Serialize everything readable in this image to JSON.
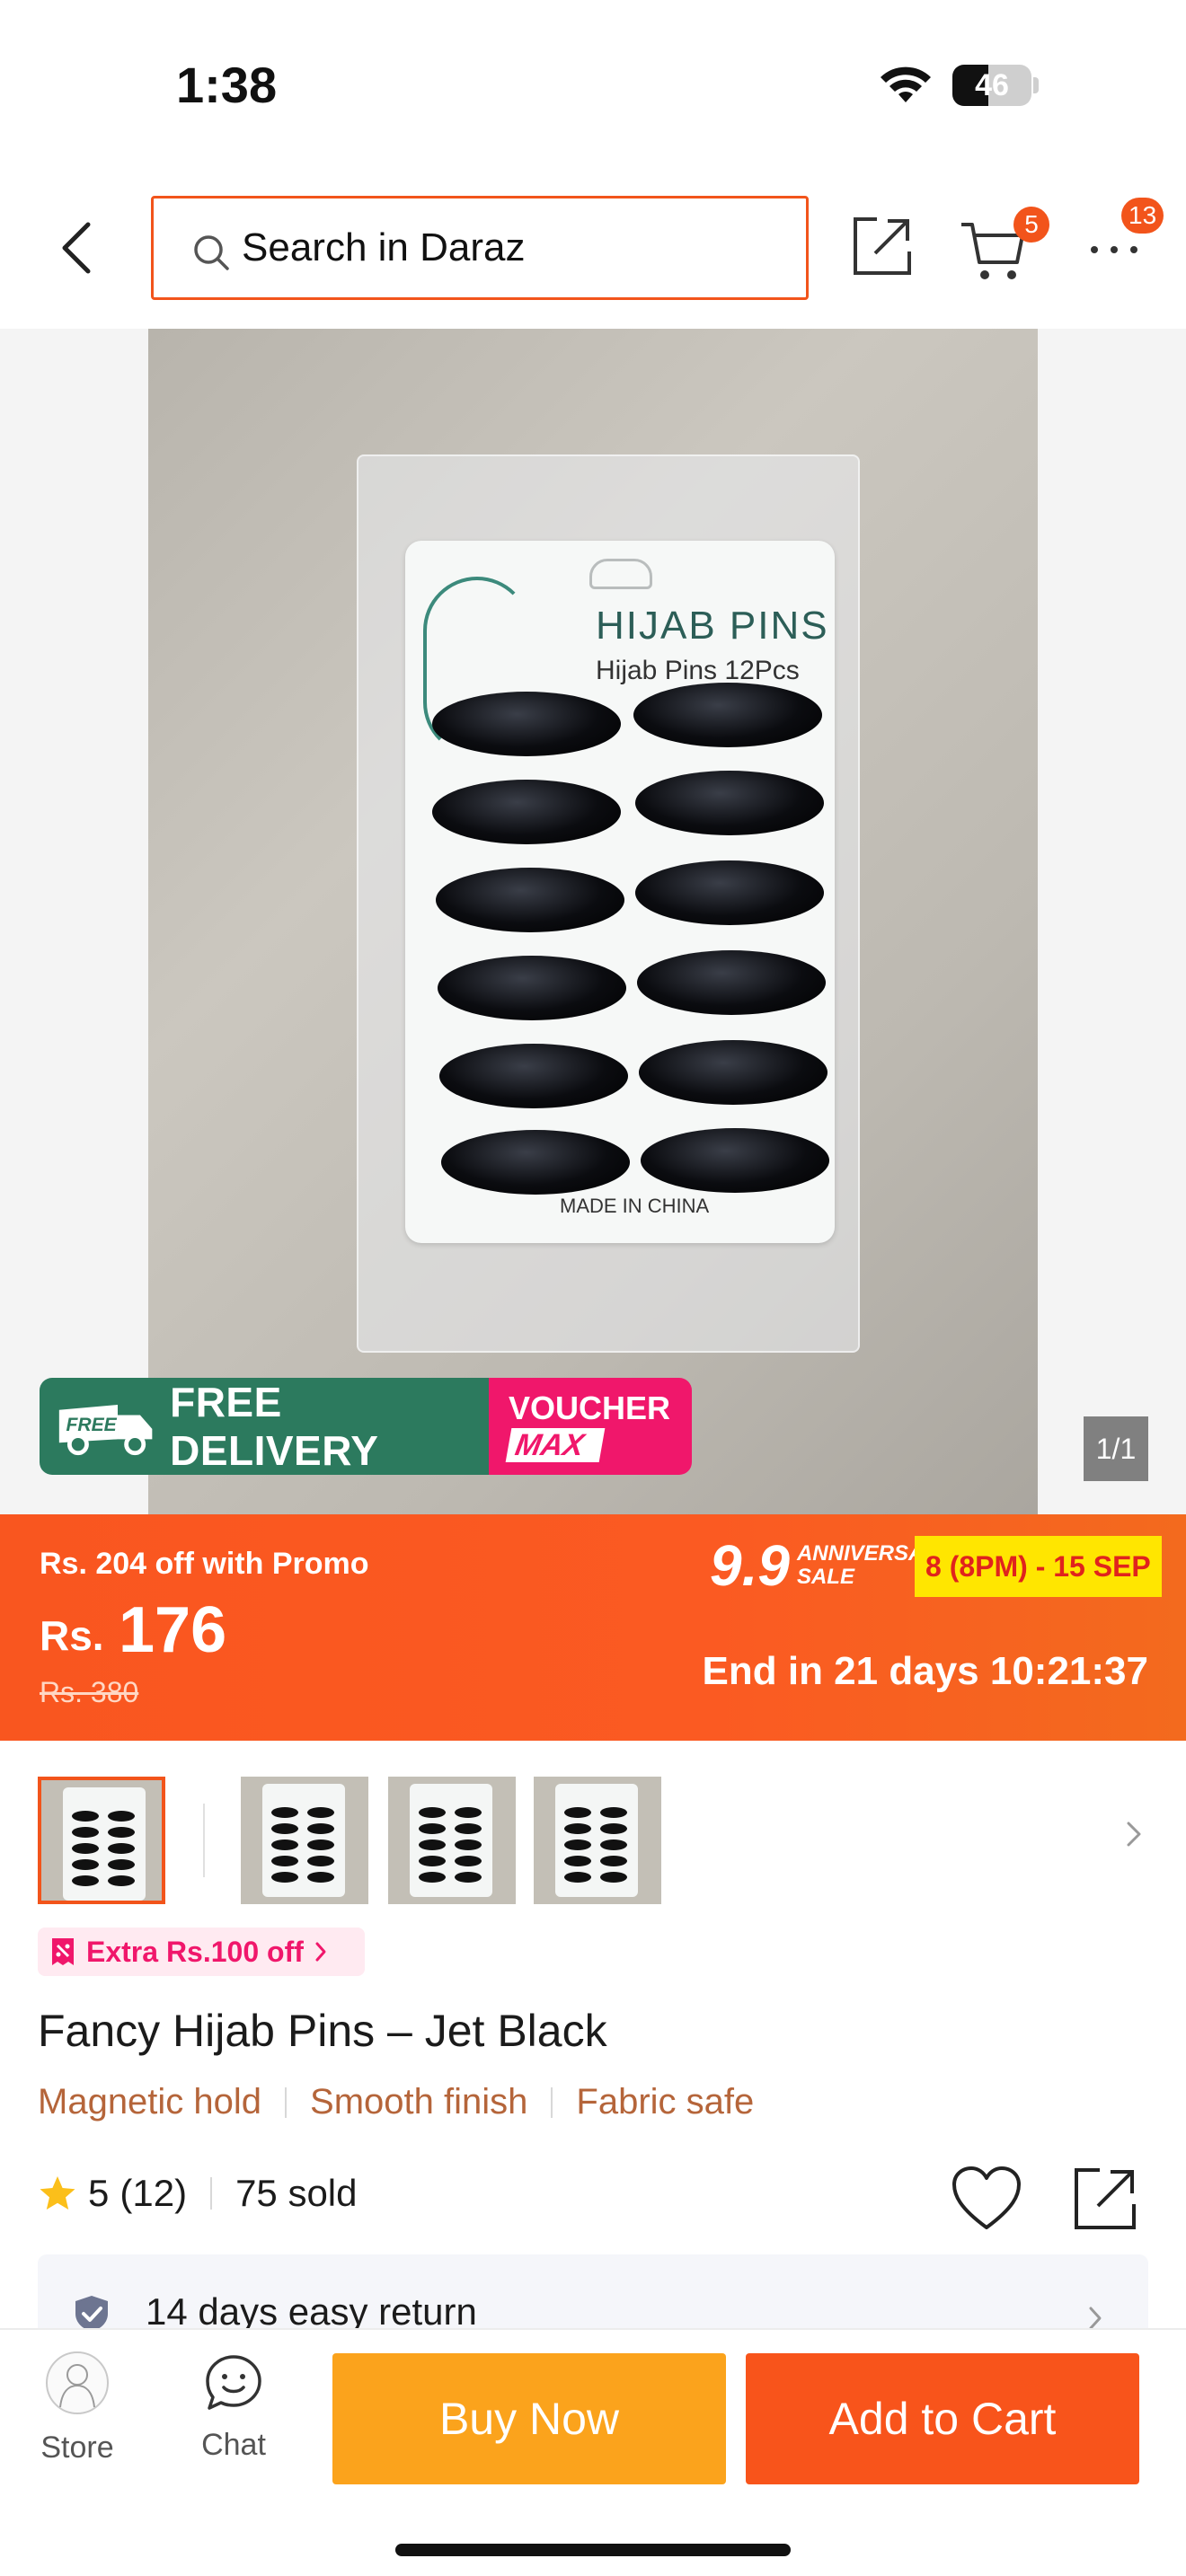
{
  "status_bar": {
    "time": "1:38",
    "battery": "46",
    "battery_level": 0.46
  },
  "header": {
    "search_placeholder": "Search in Daraz",
    "cart_badge": "5",
    "more_badge": "13"
  },
  "gallery": {
    "product_box_brand": "HIJAB PINS",
    "product_box_subtitle": "Hijab Pins 12Pcs",
    "product_box_origin": "MADE IN CHINA",
    "free_delivery_label": "FREE DELIVERY",
    "free_truck_label": "FREE",
    "voucher_label": "VOUCHER",
    "voucher_max_label": "MAX",
    "image_counter": "1/1"
  },
  "price_banner": {
    "promo_text": "Rs. 204 off with Promo",
    "currency": "Rs.",
    "price": "176",
    "original_price": "Rs. 380",
    "sale_number": "9.9",
    "sale_word_1": "ANNIVERSARY",
    "sale_word_2": "SALE",
    "sale_dates": "8 (8PM) - 15 SEP",
    "countdown": "End in 21 days 10:21:37"
  },
  "voucher_chip": {
    "text": "Extra Rs.100 off"
  },
  "product": {
    "title": "Fancy Hijab Pins – Jet Black",
    "features": [
      "Magnetic hold",
      "Smooth finish",
      "Fabric safe"
    ],
    "rating": "5",
    "rating_count": "(12)",
    "sold": "75 sold"
  },
  "return_policy": {
    "text": "14 days easy return"
  },
  "bottom_bar": {
    "store_label": "Store",
    "chat_label": "Chat",
    "buy_now_label": "Buy Now",
    "add_to_cart_label": "Add to Cart"
  },
  "colors": {
    "accent": "#f8541b",
    "buy_now": "#fba31c",
    "feature_text": "#b5653a",
    "voucher_pink": "#f0176b",
    "free_delivery_green": "#2c7a5e",
    "sale_dates_bg": "#ffe600"
  },
  "icons": [
    "wifi-icon",
    "back-icon",
    "search-icon",
    "share-icon",
    "cart-icon",
    "more-icon",
    "truck-icon",
    "voucher-icon",
    "chevron-right-icon",
    "star-icon",
    "heart-icon",
    "shield-icon",
    "store-avatar-icon",
    "chat-icon"
  ]
}
